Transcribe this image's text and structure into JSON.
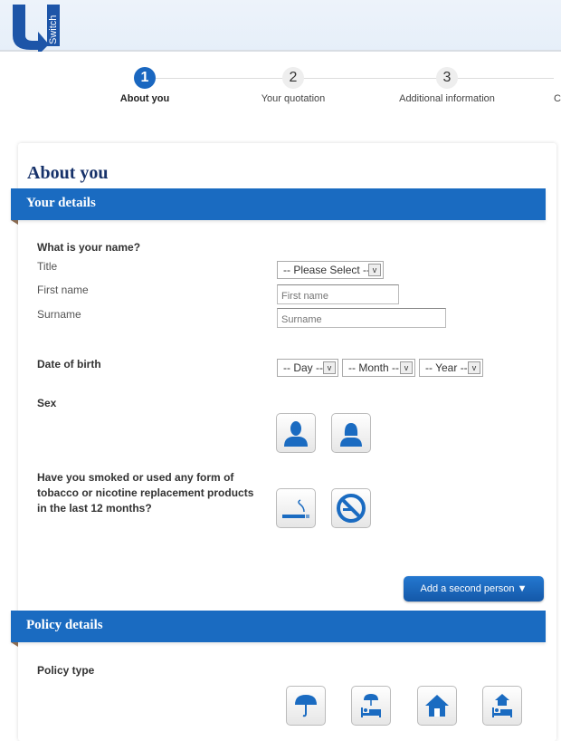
{
  "brand": {
    "logo_text": "Switch"
  },
  "stepper": [
    {
      "number": "1",
      "label": "About you",
      "active": true
    },
    {
      "number": "2",
      "label": "Your quotation"
    },
    {
      "number": "3",
      "label": "Additional information"
    },
    {
      "label": "C"
    }
  ],
  "page_title": "About you",
  "your_details": {
    "heading": "Your details",
    "name_question": "What is your name?",
    "title_label": "Title",
    "title_select": "-- Please Select --",
    "first_name_label": "First name",
    "first_name_placeholder": "First name",
    "surname_label": "Surname",
    "surname_placeholder": "Surname",
    "dob_label": "Date of birth",
    "day": "-- Day --",
    "month": "-- Month --",
    "year": "-- Year --",
    "sex_label": "Sex",
    "sex_options": [
      "male-icon",
      "female-icon"
    ],
    "smoker_question": "Have you smoked or used any form of tobacco or nicotine replacement products in the last 12 months?",
    "smoker_options": [
      "smoking-icon",
      "no-smoking-icon"
    ],
    "add_person": "Add a second person ▼"
  },
  "policy_details": {
    "heading": "Policy details",
    "policy_type_label": "Policy type",
    "options": [
      "umbrella-icon",
      "umbrella-bed-icon",
      "house-icon",
      "house-bed-icon"
    ]
  },
  "colors": {
    "accent": "#1a6bc1",
    "title": "#17326a"
  }
}
